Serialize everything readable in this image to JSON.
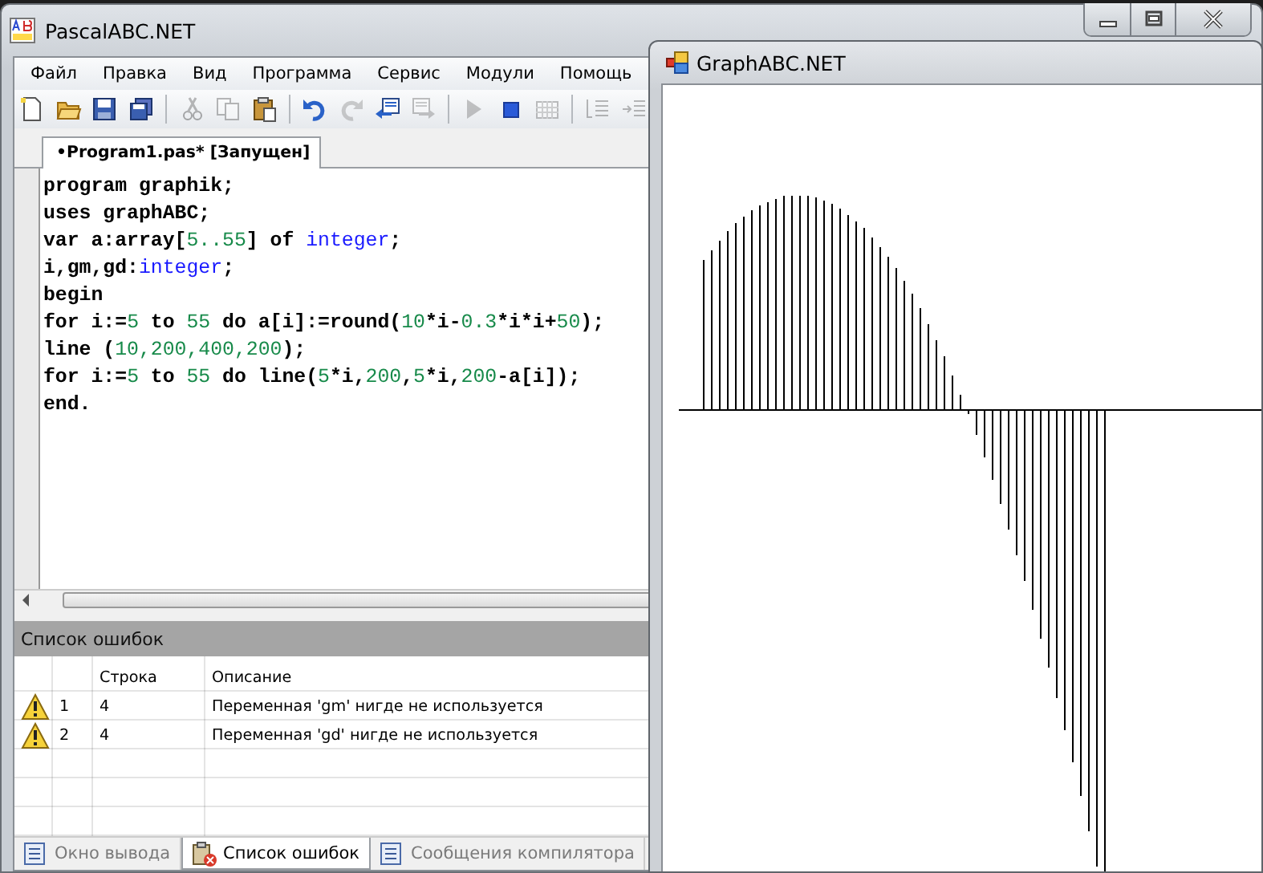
{
  "main_window": {
    "title": "PascalABC.NET",
    "menu": [
      "Файл",
      "Правка",
      "Вид",
      "Программа",
      "Сервис",
      "Модули",
      "Помощь"
    ],
    "toolbar": [
      {
        "kind": "new",
        "disabled": false
      },
      {
        "kind": "open",
        "disabled": false
      },
      {
        "kind": "save",
        "disabled": false
      },
      {
        "kind": "save_all",
        "disabled": false
      },
      {
        "kind": "separator"
      },
      {
        "kind": "cut",
        "disabled": true
      },
      {
        "kind": "copy",
        "disabled": true
      },
      {
        "kind": "paste",
        "disabled": false
      },
      {
        "kind": "separator"
      },
      {
        "kind": "undo",
        "disabled": false
      },
      {
        "kind": "redo",
        "disabled": true
      },
      {
        "kind": "doc_in",
        "disabled": false
      },
      {
        "kind": "doc_out",
        "disabled": true
      },
      {
        "kind": "separator"
      },
      {
        "kind": "run",
        "disabled": true
      },
      {
        "kind": "stop",
        "disabled": false
      },
      {
        "kind": "grid",
        "disabled": true
      },
      {
        "kind": "separator"
      },
      {
        "kind": "indent",
        "disabled": true
      },
      {
        "kind": "unindent",
        "disabled": true
      }
    ],
    "editor_tabs": [
      {
        "label": "•Program1.pas* [Запущен]",
        "selected": true
      }
    ],
    "code_lines": [
      [
        {
          "kind": "text",
          "text": "program graphik;"
        }
      ],
      [
        {
          "kind": "text",
          "text": "uses graphABC;"
        }
      ],
      [
        {
          "kind": "text",
          "text": "var a:array["
        },
        {
          "kind": "number",
          "text": "5..55"
        },
        {
          "kind": "text",
          "text": "] of "
        },
        {
          "kind": "type",
          "text": "integer"
        },
        {
          "kind": "text",
          "text": ";"
        }
      ],
      [
        {
          "kind": "text",
          "text": "i,gm,gd:"
        },
        {
          "kind": "type",
          "text": "integer"
        },
        {
          "kind": "text",
          "text": ";"
        }
      ],
      [
        {
          "kind": "text",
          "text": "begin"
        }
      ],
      [
        {
          "kind": "text",
          "text": "for i:="
        },
        {
          "kind": "number",
          "text": "5"
        },
        {
          "kind": "text",
          "text": " to "
        },
        {
          "kind": "number",
          "text": "55"
        },
        {
          "kind": "text",
          "text": " do a[i]:=round("
        },
        {
          "kind": "number",
          "text": "10"
        },
        {
          "kind": "text",
          "text": "*i-"
        },
        {
          "kind": "number",
          "text": "0.3"
        },
        {
          "kind": "text",
          "text": "*i*i+"
        },
        {
          "kind": "number",
          "text": "50"
        },
        {
          "kind": "text",
          "text": ");"
        }
      ],
      [
        {
          "kind": "text",
          "text": "line ("
        },
        {
          "kind": "number",
          "text": "10,200,400,200"
        },
        {
          "kind": "text",
          "text": ");"
        }
      ],
      [
        {
          "kind": "text",
          "text": "for i:="
        },
        {
          "kind": "number",
          "text": "5"
        },
        {
          "kind": "text",
          "text": " to "
        },
        {
          "kind": "number",
          "text": "55"
        },
        {
          "kind": "text",
          "text": " do line("
        },
        {
          "kind": "number",
          "text": "5"
        },
        {
          "kind": "text",
          "text": "*i,"
        },
        {
          "kind": "number",
          "text": "200"
        },
        {
          "kind": "text",
          "text": ","
        },
        {
          "kind": "number",
          "text": "5"
        },
        {
          "kind": "text",
          "text": "*i,"
        },
        {
          "kind": "number",
          "text": "200"
        },
        {
          "kind": "text",
          "text": "-a[i]);"
        }
      ],
      [
        {
          "kind": "text",
          "text": "end."
        }
      ]
    ],
    "error_panel": {
      "title": "Список ошибок",
      "columns": [
        "Строка",
        "Описание"
      ],
      "rows": [
        {
          "kind": "warning",
          "number": "1",
          "line": "4",
          "description": "Переменная 'gm' нигде не используется"
        },
        {
          "kind": "warning",
          "number": "2",
          "line": "4",
          "description": "Переменная 'gd' нигде не используется"
        }
      ]
    },
    "bottom_tabs": [
      {
        "kind": "output",
        "label": "Окно вывода",
        "selected": false
      },
      {
        "kind": "errors",
        "label": "Список ошибок",
        "selected": true
      },
      {
        "kind": "compiler",
        "label": "Сообщения компилятора",
        "selected": false
      }
    ]
  },
  "graph_window": {
    "title": "GraphABC.NET"
  }
}
